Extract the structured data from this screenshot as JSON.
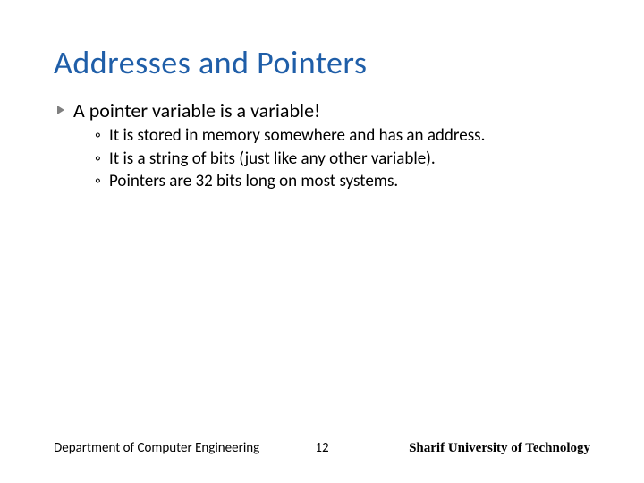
{
  "title": "Addresses and Pointers",
  "main_bullet": "A pointer variable is a variable!",
  "sub_bullets": [
    "It is stored in memory somewhere and has an address.",
    "It is a string of bits (just like any other variable).",
    "Pointers are 32 bits long on most systems."
  ],
  "footer": {
    "left": "Department of Computer Engineering",
    "page": "12",
    "right": "Sharif University of Technology"
  }
}
